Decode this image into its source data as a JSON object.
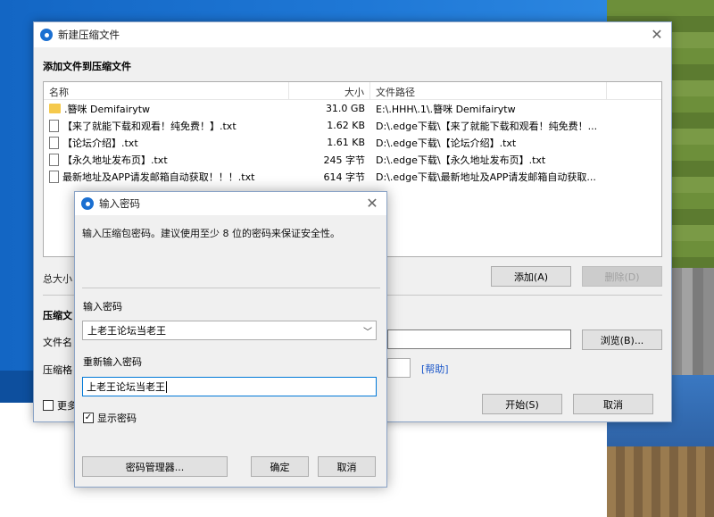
{
  "main_window": {
    "title": "新建压缩文件",
    "section_title": "添加文件到压缩文件",
    "columns": {
      "name": "名称",
      "size": "大小",
      "path": "文件路径"
    },
    "files": [
      {
        "icon": "folder-icon",
        "name": ".簪咪 Demifairytw",
        "size": "31.0 GB",
        "path": "E:\\.HHH\\.1\\.簪咪 Demifairytw"
      },
      {
        "icon": "document-icon",
        "name": "【来了就能下载和观看！纯免费！】.txt",
        "size": "1.62 KB",
        "path": "D:\\.edge下载\\【来了就能下载和观看！纯免费！..."
      },
      {
        "icon": "document-icon",
        "name": "【论坛介绍】.txt",
        "size": "1.61 KB",
        "path": "D:\\.edge下载\\【论坛介绍】.txt"
      },
      {
        "icon": "document-icon",
        "name": "【永久地址发布页】.txt",
        "size": "245 字节",
        "path": "D:\\.edge下载\\【永久地址发布页】.txt"
      },
      {
        "icon": "document-icon",
        "name": "最新地址及APP请发邮箱自动获取！！！.txt",
        "size": "614 字节",
        "path": "D:\\.edge下载\\最新地址及APP请发邮箱自动获取..."
      }
    ],
    "total_label": "总大小",
    "add_button": "添加(A)",
    "delete_button": "删除(D)",
    "archive_section": "压缩文",
    "filename_label": "文件名",
    "format_label": "压缩格",
    "browse_button": "浏览(B)...",
    "help_link": "[帮助]",
    "more_label": "更多",
    "start_button": "开始(S)",
    "cancel_button": "取消"
  },
  "password_dialog": {
    "title": "输入密码",
    "description": "输入压缩包密码。建议使用至少 8 位的密码来保证安全性。",
    "password_label": "输入密码",
    "password_value": "上老王论坛当老王",
    "reenter_label": "重新输入密码",
    "reenter_value": "上老王论坛当老王",
    "show_password_label": "显示密码",
    "show_password_checked": true,
    "manager_button": "密码管理器...",
    "ok_button": "确定",
    "cancel_button": "取消"
  },
  "colors": {
    "accent": "#0078d7",
    "link": "#1a56c9",
    "desktop_blue": "#1f78d6"
  }
}
